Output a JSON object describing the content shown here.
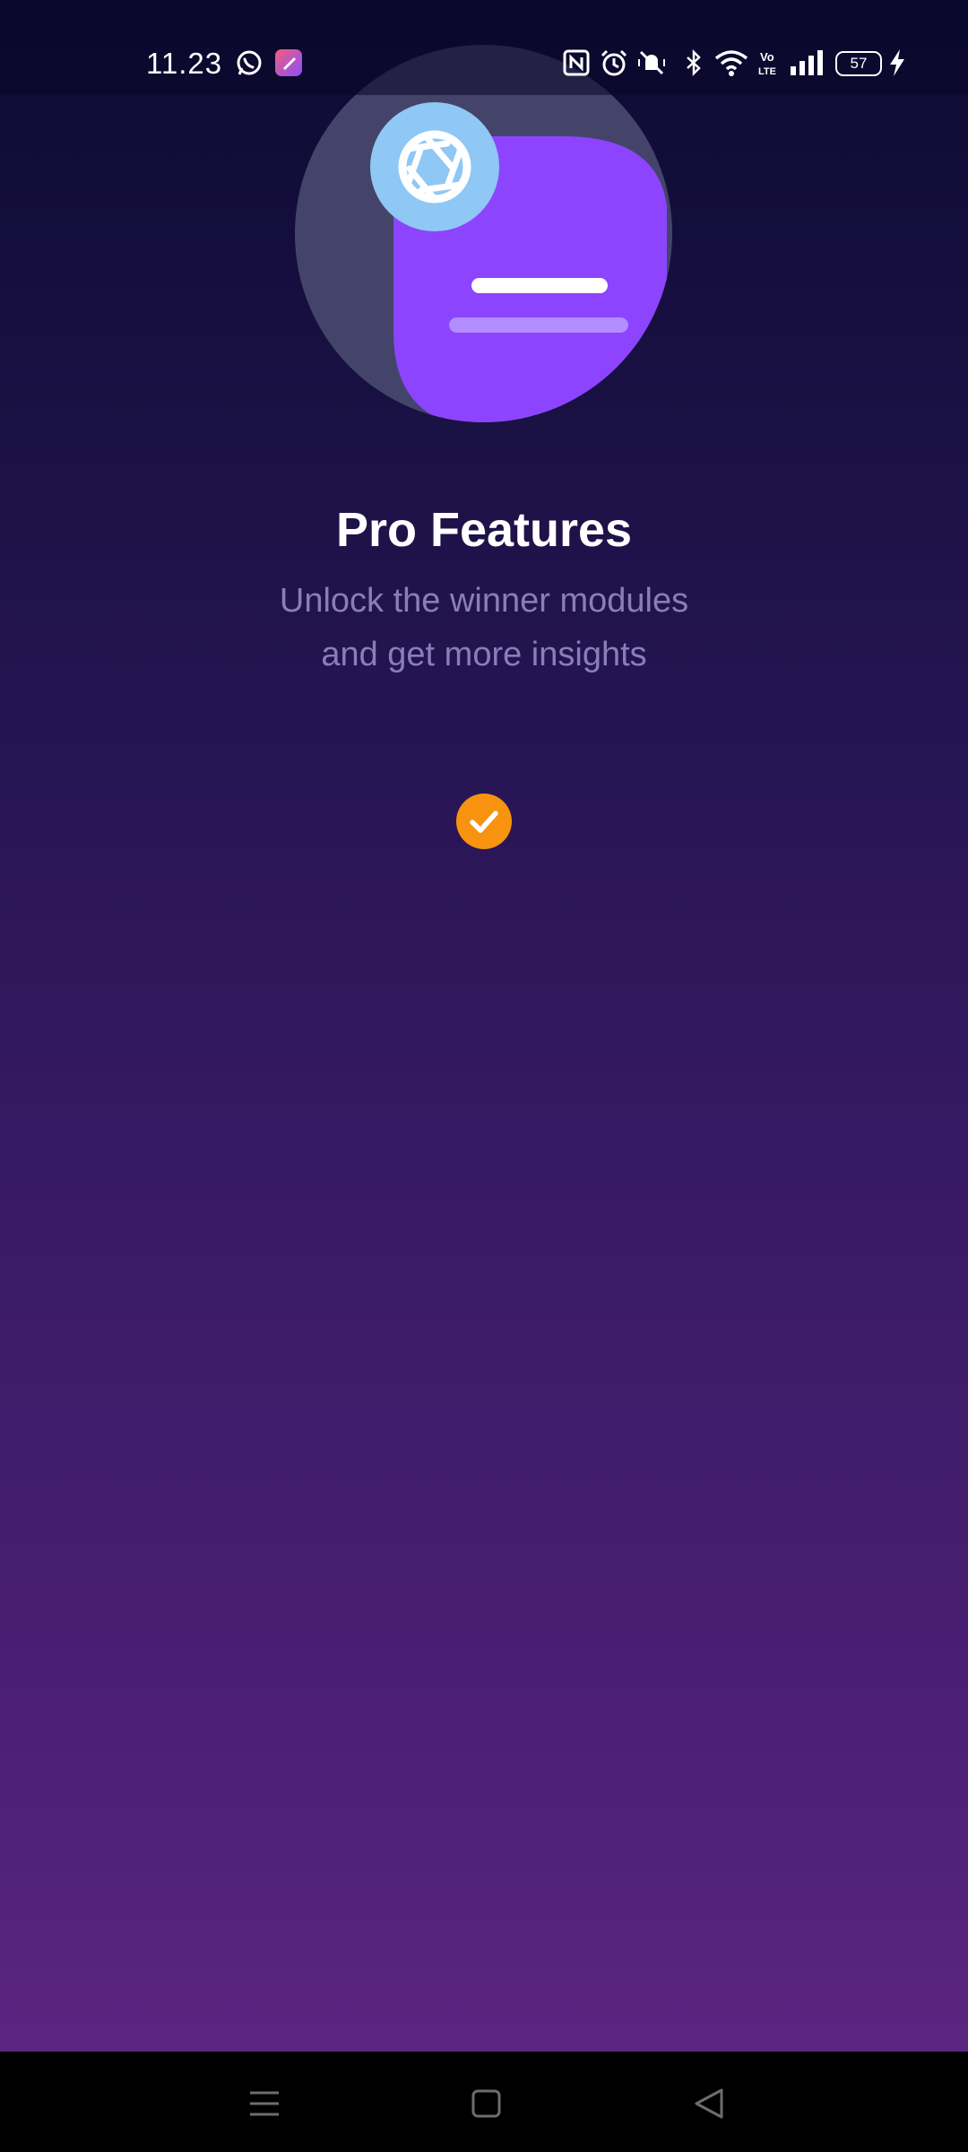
{
  "status_bar": {
    "time": "11.23",
    "battery": "57",
    "icons": [
      "whatsapp-icon",
      "app-notification-icon",
      "nfc-icon",
      "alarm-icon",
      "vibrate-mute-icon",
      "bluetooth-icon",
      "wifi-icon",
      "volte-icon",
      "signal-icon",
      "battery-icon",
      "charging-icon"
    ]
  },
  "hero": {
    "icon": "camera-aperture-icon",
    "colors": {
      "circle": "#44446a",
      "card": "#8c44ff",
      "badge": "#8fc7f5"
    }
  },
  "content": {
    "title": "Pro Features",
    "subtitle_line1": "Unlock the winner modules",
    "subtitle_line2": "and get more insights",
    "badge_icon": "check-icon",
    "badge_color": "#f7930f"
  },
  "nav_bar": {
    "items": [
      "menu-icon",
      "home-icon",
      "back-icon"
    ]
  }
}
